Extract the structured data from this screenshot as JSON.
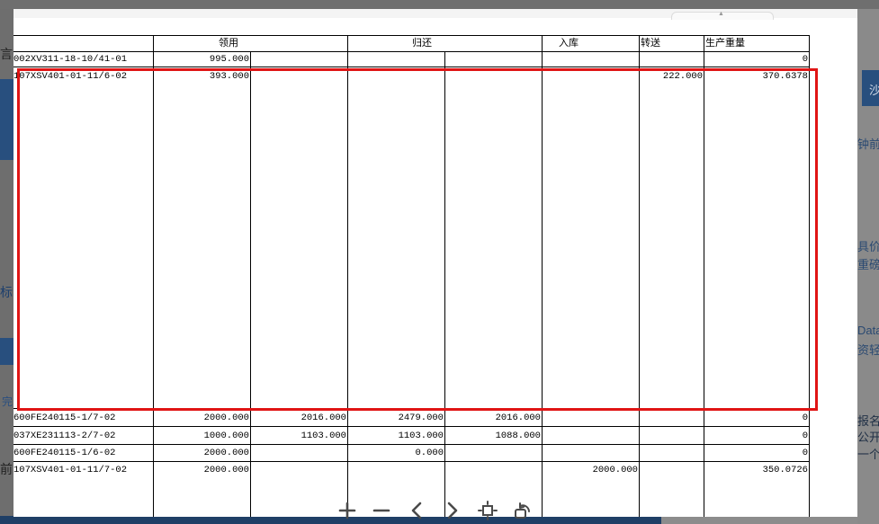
{
  "background": {
    "fragments": [
      "言",
      "标",
      "完",
      "前",
      "沙",
      "钟前",
      "具价",
      "重磅",
      "Data",
      "资轻",
      "报名",
      "公开",
      "一个"
    ]
  },
  "table": {
    "headers": {
      "group_lingyong": "领用",
      "group_guihuan": "归还",
      "ruku": "入库",
      "zhuansong": "转送",
      "shengchan": "生产重量"
    },
    "rows": [
      {
        "code": "002XV311-18-10/41-01",
        "v1": "995.000",
        "v2": "",
        "v3": "",
        "v4": "",
        "v5": "",
        "v6": "",
        "v7": "0"
      },
      {
        "code": "107XSV401-01-11/6-02",
        "v1": "393.000",
        "v2": "",
        "v3": "",
        "v4": "",
        "v5": "",
        "v6": "222.000",
        "v7": "370.6378"
      },
      {
        "code": "600FE240115-1/7-02",
        "v1": "2000.000",
        "v2": "2016.000",
        "v3": "2479.000",
        "v4": "2016.000",
        "v5": "",
        "v6": "",
        "v7": "0"
      },
      {
        "code": "037XE231113-2/7-02",
        "v1": "1000.000",
        "v2": "1103.000",
        "v3": "1103.000",
        "v4": "1088.000",
        "v5": "",
        "v6": "",
        "v7": "0"
      },
      {
        "code": "600FE240115-1/6-02",
        "v1": "2000.000",
        "v2": "",
        "v3": "0.000",
        "v4": "",
        "v5": "",
        "v6": "",
        "v7": "0"
      },
      {
        "code": "107XSV401-01-11/7-02",
        "v1": "2000.000",
        "v2": "",
        "v3": "",
        "v4": "",
        "v5": "2000.000",
        "v6": "",
        "v7": "350.0726"
      }
    ]
  },
  "toolbar": {
    "icons": [
      "zoom-in-icon",
      "zoom-out-icon",
      "previous-icon",
      "next-icon",
      "fit-to-screen-icon",
      "rotate-icon"
    ]
  },
  "colors": {
    "highlight": "#e01515",
    "dim_overlay": "#8c8c8c",
    "accent_blue": "#284f7e"
  }
}
